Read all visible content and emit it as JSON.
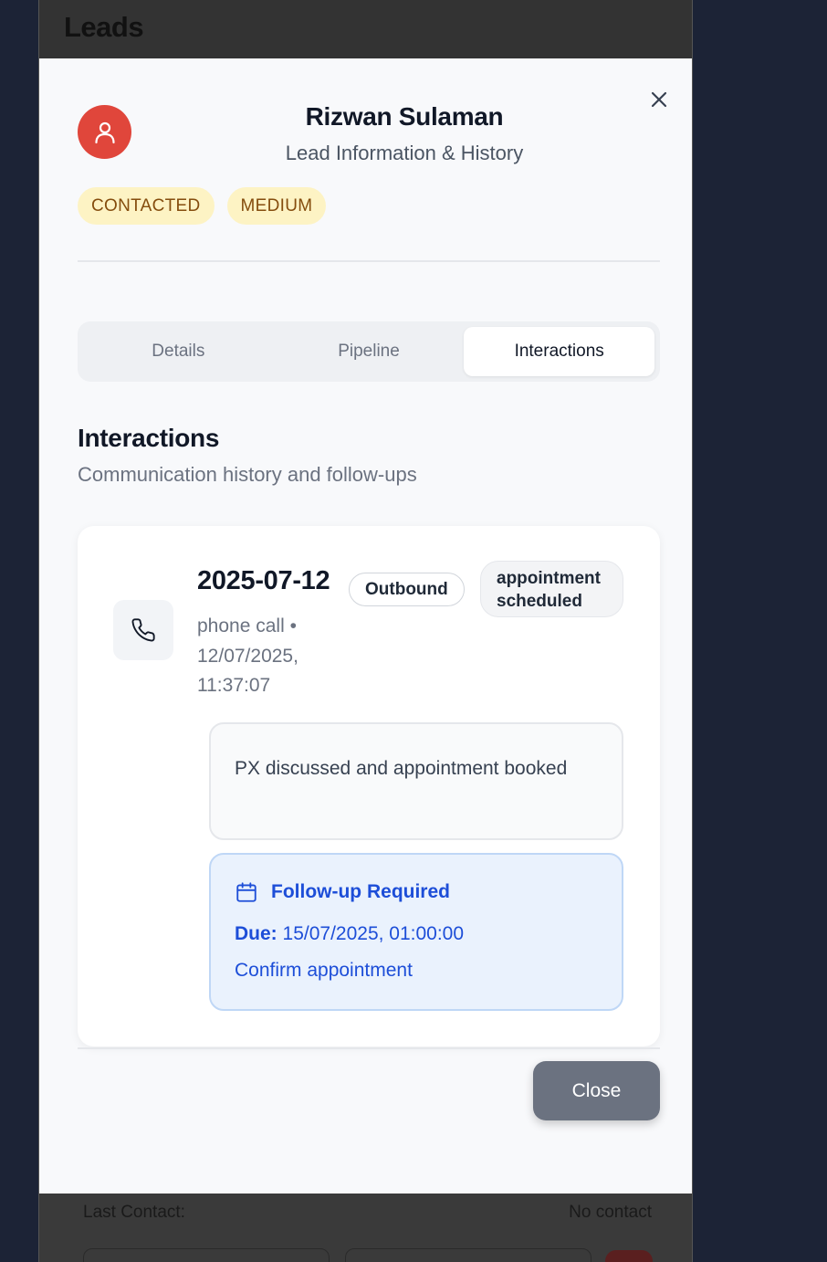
{
  "background": {
    "page_title": "Leads",
    "last_contact_label": "Last Contact:",
    "last_contact_value": "No contact"
  },
  "modal": {
    "close_icon": "close-icon",
    "name": "Rizwan Sulaman",
    "subtitle": "Lead Information & History",
    "badges": [
      "CONTACTED",
      "MEDIUM"
    ],
    "tabs": [
      "Details",
      "Pipeline",
      "Interactions"
    ],
    "active_tab": "Interactions",
    "section_title": "Interactions",
    "section_subtitle": "Communication history and follow-ups",
    "interaction": {
      "date": "2025-07-12",
      "direction": "Outbound",
      "outcome": "appointment scheduled",
      "type": "phone call",
      "timestamp": "12/07/2025, 11:37:07",
      "notes": "PX discussed and appointment booked",
      "followup": {
        "title": "Follow-up Required",
        "due_label": "Due:",
        "due_value": "15/07/2025, 01:00:00",
        "note": "Confirm appointment"
      }
    },
    "close_label": "Close"
  },
  "colors": {
    "avatar": "#e0463b",
    "badge_bg": "#fdf3c4",
    "badge_text": "#854d0e",
    "followup_text": "#1d4ed8",
    "followup_bg": "#eaf2fd",
    "close_button": "#6b7280"
  }
}
